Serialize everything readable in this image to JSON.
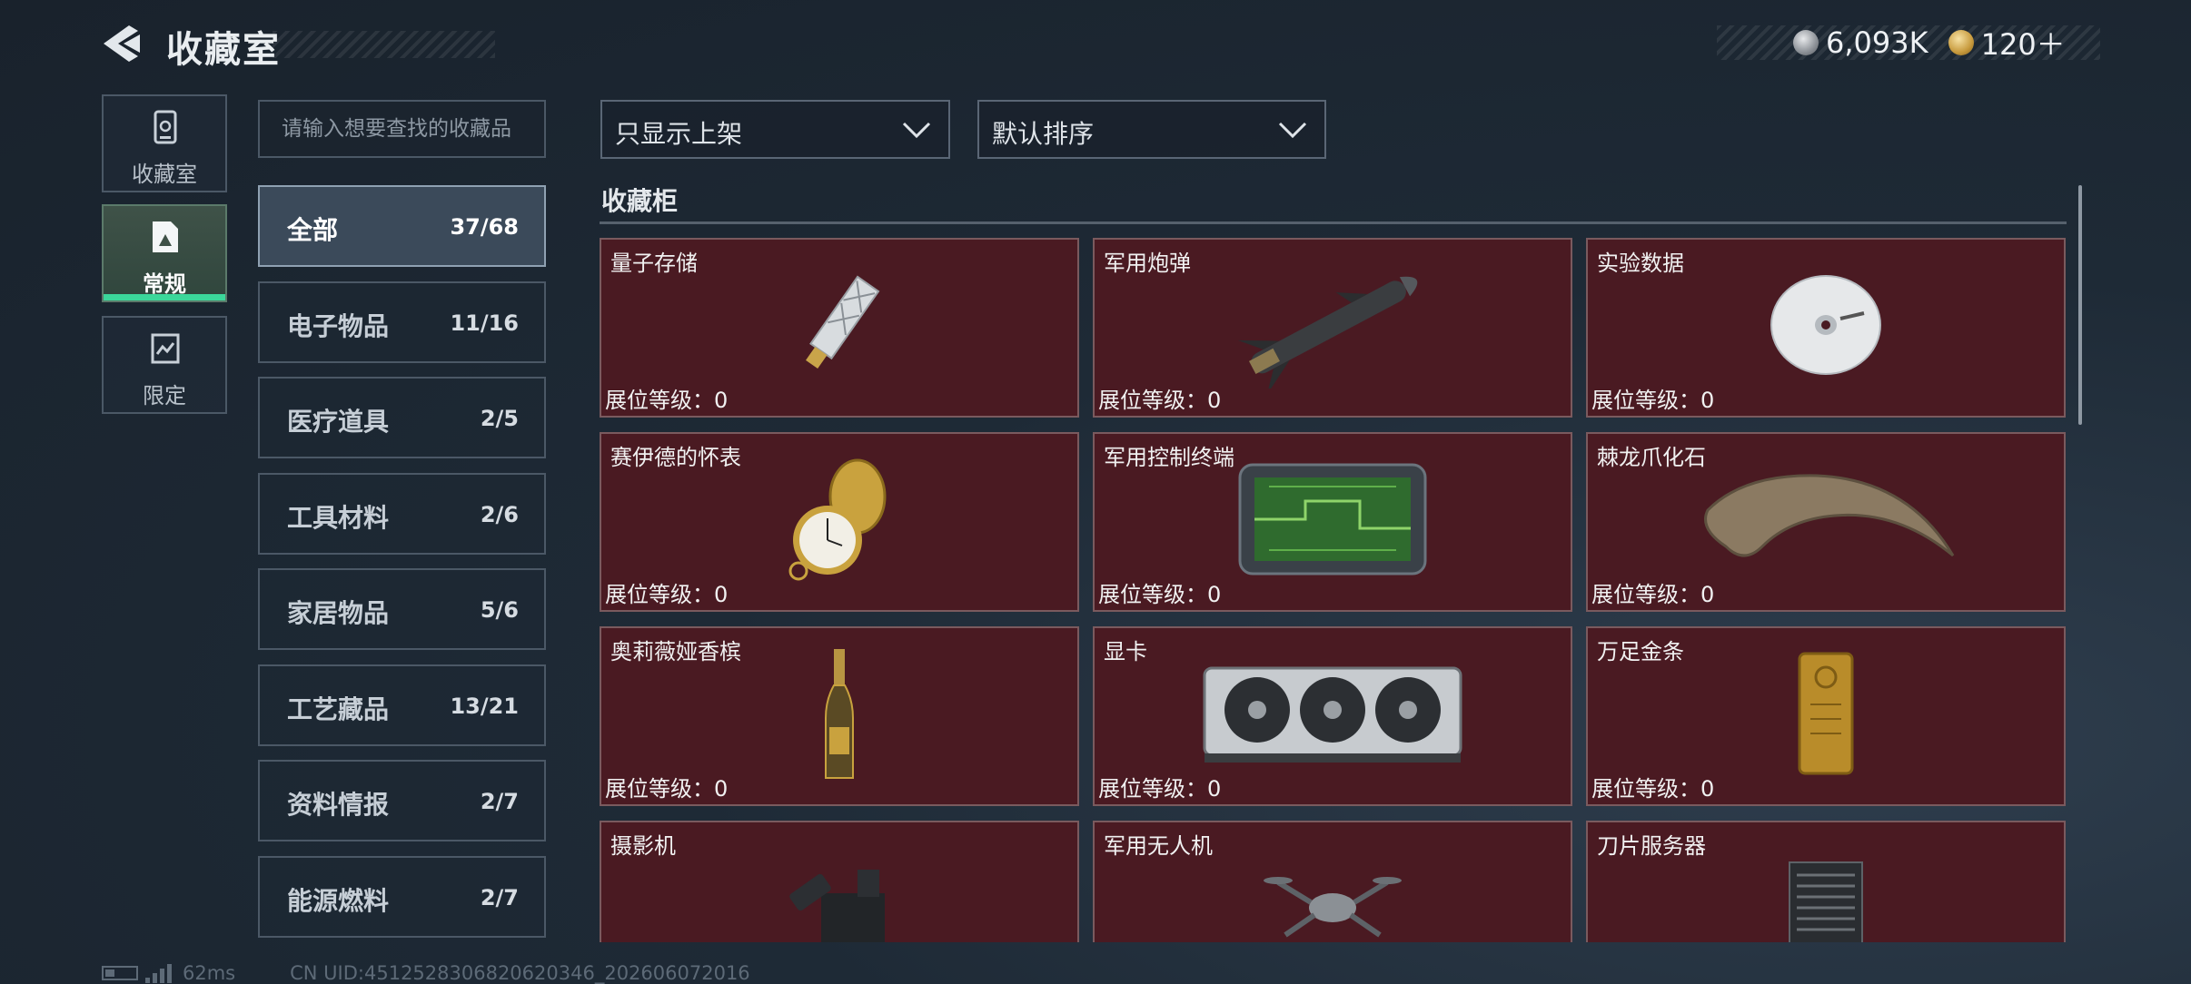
{
  "header": {
    "title": "收藏室"
  },
  "currency": {
    "silver": "6,093K",
    "gold": "120＋"
  },
  "nav": [
    {
      "label": "收藏室",
      "icon": "collection-room-icon"
    },
    {
      "label": "常规",
      "icon": "regular-icon",
      "selected": true
    },
    {
      "label": "限定",
      "icon": "limited-icon"
    }
  ],
  "search": {
    "placeholder": "请输入想要查找的收藏品",
    "value": ""
  },
  "categories": [
    {
      "name": "全部",
      "count": "37/68",
      "selected": true
    },
    {
      "name": "电子物品",
      "count": "11/16"
    },
    {
      "name": "医疗道具",
      "count": "2/5"
    },
    {
      "name": "工具材料",
      "count": "2/6"
    },
    {
      "name": "家居物品",
      "count": "5/6"
    },
    {
      "name": "工艺藏品",
      "count": "13/21"
    },
    {
      "name": "资料情报",
      "count": "2/7"
    },
    {
      "name": "能源燃料",
      "count": "2/7"
    }
  ],
  "filters": {
    "display": "只显示上架",
    "sort": "默认排序"
  },
  "section": {
    "title": "收藏柜"
  },
  "items": [
    {
      "name": "量子存储",
      "level": "展位等级：0",
      "icon": "quantum-storage-icon"
    },
    {
      "name": "军用炮弹",
      "level": "展位等级：0",
      "icon": "missile-icon"
    },
    {
      "name": "实验数据",
      "level": "展位等级：0",
      "icon": "disc-icon"
    },
    {
      "name": "赛伊德的怀表",
      "level": "展位等级：0",
      "icon": "pocket-watch-icon"
    },
    {
      "name": "军用控制终端",
      "level": "展位等级：0",
      "icon": "control-terminal-icon"
    },
    {
      "name": "棘龙爪化石",
      "level": "展位等级：0",
      "icon": "claw-fossil-icon"
    },
    {
      "name": "奥莉薇娅香槟",
      "level": "展位等级：0",
      "icon": "champagne-icon"
    },
    {
      "name": "显卡",
      "level": "展位等级：0",
      "icon": "graphics-card-icon"
    },
    {
      "name": "万足金条",
      "level": "展位等级：0",
      "icon": "gold-bar-icon"
    },
    {
      "name": "摄影机",
      "level": "",
      "icon": "video-camera-icon"
    },
    {
      "name": "军用无人机",
      "level": "",
      "icon": "drone-icon"
    },
    {
      "name": "刀片服务器",
      "level": "",
      "icon": "blade-server-icon"
    }
  ],
  "footer": {
    "ping": "62ms",
    "uid": "CN UID:4512528306820620346_202606072016"
  }
}
